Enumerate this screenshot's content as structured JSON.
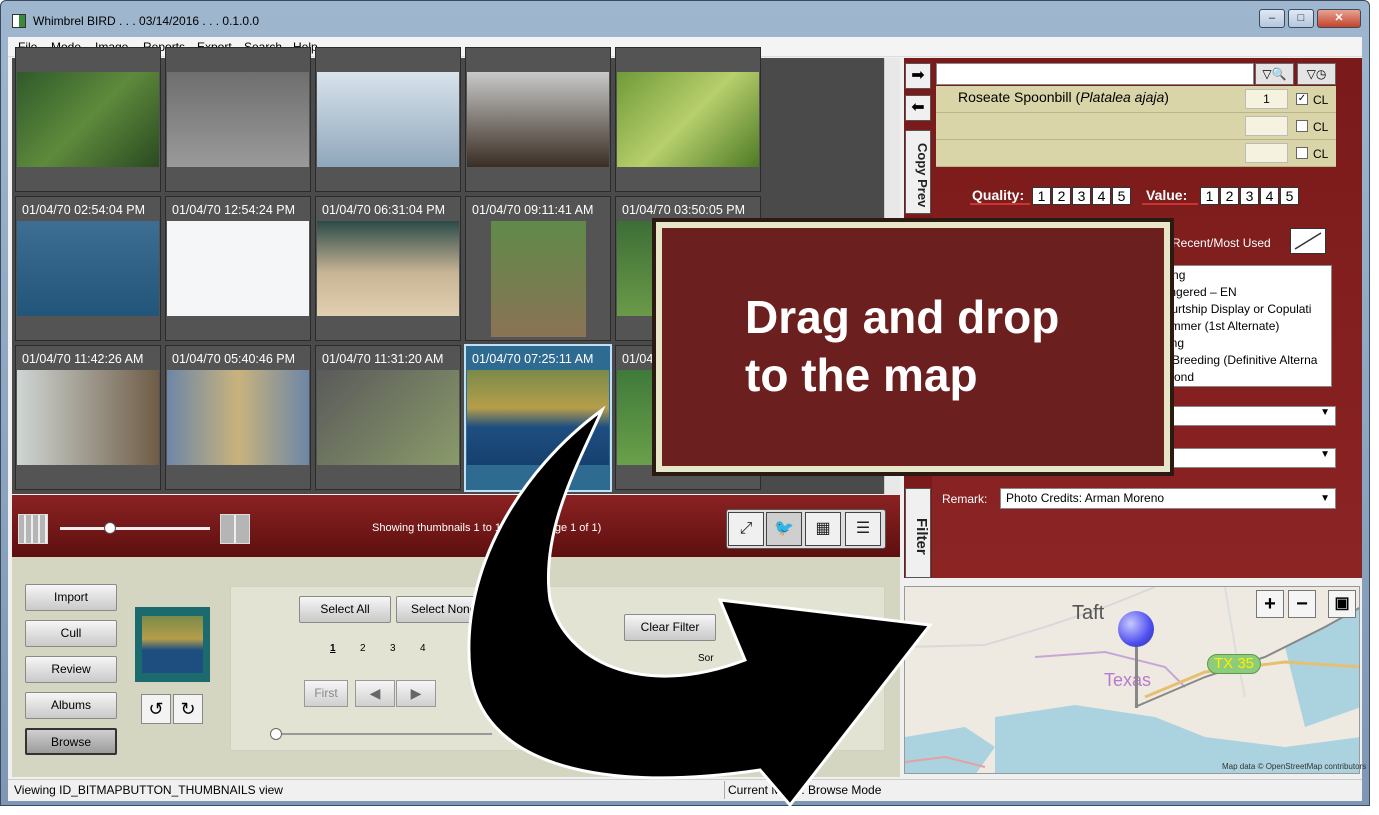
{
  "window": {
    "title": "Whimbrel BIRD . . . 03/14/2016 . . . 0.1.0.0",
    "minimize": "–",
    "maximize": "□",
    "close": "✕"
  },
  "menu": [
    "File",
    "Mode",
    "Image",
    "Reports",
    "Export",
    "Search",
    "Help"
  ],
  "thumbnails": [
    {
      "timestamp": ""
    },
    {
      "timestamp": ""
    },
    {
      "timestamp": ""
    },
    {
      "timestamp": ""
    },
    {
      "timestamp": ""
    },
    {
      "timestamp": "01/04/70 02:54:04 PM"
    },
    {
      "timestamp": "01/04/70 12:54:24 PM"
    },
    {
      "timestamp": "01/04/70 06:31:04 PM"
    },
    {
      "timestamp": "01/04/70 09:11:41 AM"
    },
    {
      "timestamp": "01/04/70 03:50:05 PM"
    },
    {
      "timestamp": "01/04/70 11:42:26 AM"
    },
    {
      "timestamp": "01/04/70 05:40:46 PM"
    },
    {
      "timestamp": "01/04/70 11:31:20 AM"
    },
    {
      "timestamp": "01/04/70 07:25:11 AM",
      "selected": true
    },
    {
      "timestamp": "01/04/70"
    }
  ],
  "toolbar": {
    "showing_text": "Showing thumbnails 1 to 15 of 75 (Page 1 of 1)"
  },
  "modes": [
    "Import",
    "Cull",
    "Review",
    "Albums",
    "Browse"
  ],
  "selection": {
    "select_all": "Select All",
    "select_none": "Select None",
    "clear_filter": "Clear Filter",
    "sort_label": "Sor",
    "pages": [
      "1",
      "2",
      "3",
      "4"
    ],
    "first": "First"
  },
  "statusbar": {
    "left": "Viewing ID_BITMAPBUTTON_THUMBNAILS view",
    "right": "Current Mode: Browse Mode"
  },
  "right_panel": {
    "copy_prev": "Copy Prev",
    "filter_tab": "Filter",
    "species": [
      {
        "common": "Roseate Spoonbill",
        "latin": "Platalea ajaja",
        "count": "1",
        "checked": true,
        "cl": "CL"
      },
      {
        "common": "",
        "latin": "",
        "count": "",
        "checked": false,
        "cl": "CL"
      },
      {
        "common": "",
        "latin": "",
        "count": "",
        "checked": false,
        "cl": "CL"
      }
    ],
    "quality_label": "Quality:",
    "value_label": "Value:",
    "ratings": [
      "1",
      "2",
      "3",
      "4",
      "5"
    ],
    "recent_label": "Recent/Most Used",
    "behaviors": [
      "eding",
      "dangered – EN",
      "Courtship Display or Copulati",
      "Summer (1st Alternate)",
      "cking",
      "ult Breeding (Definitive Alterna",
      "e/Pond"
    ],
    "remark_label": "Remark:",
    "remark_value": "Photo Credits: Arman Moreno"
  },
  "map": {
    "town": "Taft",
    "state": "Texas",
    "highway": "TX 35",
    "attribution": "Map data © OpenStreetMap contributors",
    "zoom_in": "+",
    "zoom_out": "−"
  },
  "overlay": {
    "text": "Drag and drop\nto the map"
  },
  "colors": {
    "accent_dark_red": "#7a1a1a",
    "panel_tan": "#d9d5a8",
    "callout_bg": "#6b1f1f"
  }
}
